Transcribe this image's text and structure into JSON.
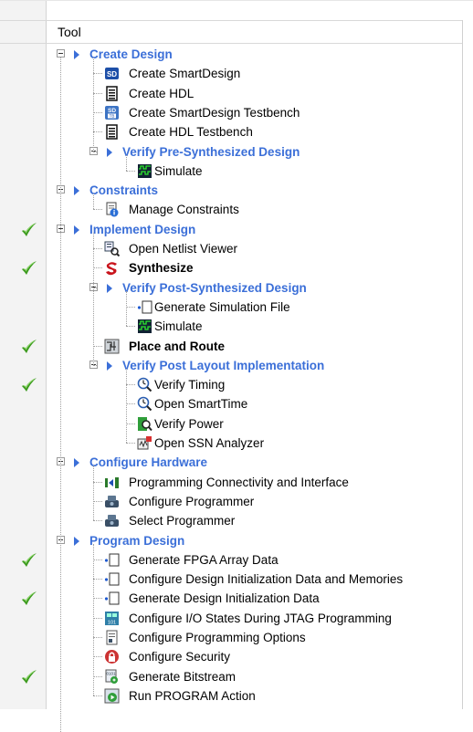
{
  "header": {
    "title": "Tool"
  },
  "colors": {
    "group": "#3b6fd8",
    "check": "#3c9a1e"
  },
  "rows": [
    {
      "label": "Create Design",
      "level": 0,
      "kind": "group",
      "checked": false
    },
    {
      "label": "Create SmartDesign",
      "level": 1,
      "icon": "smartdesign-icon",
      "checked": false
    },
    {
      "label": "Create HDL",
      "level": 1,
      "icon": "document-icon",
      "checked": false
    },
    {
      "label": "Create SmartDesign Testbench",
      "level": 1,
      "icon": "smartdesign-testbench-icon",
      "checked": false
    },
    {
      "label": "Create HDL Testbench",
      "level": 1,
      "icon": "document-icon",
      "checked": false
    },
    {
      "label": "Verify Pre-Synthesized Design",
      "level": 1,
      "kind": "group",
      "checked": false
    },
    {
      "label": "Simulate",
      "level": 2,
      "icon": "waveform-icon",
      "checked": false
    },
    {
      "label": "Constraints",
      "level": 0,
      "kind": "group",
      "checked": false
    },
    {
      "label": "Manage Constraints",
      "level": 1,
      "icon": "constraints-icon",
      "checked": false
    },
    {
      "label": "Implement Design",
      "level": 0,
      "kind": "group",
      "checked": true
    },
    {
      "label": "Open Netlist Viewer",
      "level": 1,
      "icon": "netlist-viewer-icon",
      "checked": false
    },
    {
      "label": "Synthesize",
      "level": 1,
      "icon": "synthesize-icon",
      "bold": true,
      "checked": true
    },
    {
      "label": "Verify Post-Synthesized Design",
      "level": 1,
      "kind": "group",
      "checked": false
    },
    {
      "label": "Generate Simulation File",
      "level": 2,
      "icon": "generate-file-icon",
      "checked": false
    },
    {
      "label": "Simulate",
      "level": 2,
      "icon": "waveform-icon",
      "checked": false
    },
    {
      "label": "Place and Route",
      "level": 1,
      "icon": "place-route-icon",
      "bold": true,
      "checked": true
    },
    {
      "label": "Verify Post Layout Implementation",
      "level": 1,
      "kind": "group",
      "checked": false
    },
    {
      "label": "Verify Timing",
      "level": 2,
      "icon": "timing-icon",
      "checked": true
    },
    {
      "label": "Open SmartTime",
      "level": 2,
      "icon": "timing-icon",
      "checked": false
    },
    {
      "label": "Verify Power",
      "level": 2,
      "icon": "power-icon",
      "checked": false
    },
    {
      "label": "Open SSN Analyzer",
      "level": 2,
      "icon": "ssn-analyzer-icon",
      "checked": false
    },
    {
      "label": "Configure Hardware",
      "level": 0,
      "kind": "group",
      "checked": false
    },
    {
      "label": "Programming Connectivity and Interface",
      "level": 1,
      "icon": "connectivity-icon",
      "checked": false
    },
    {
      "label": "Configure Programmer",
      "level": 1,
      "icon": "programmer-icon",
      "checked": false
    },
    {
      "label": "Select Programmer",
      "level": 1,
      "icon": "programmer-icon",
      "checked": false
    },
    {
      "label": "Program Design",
      "level": 0,
      "kind": "group",
      "checked": false
    },
    {
      "label": "Generate FPGA Array Data",
      "level": 1,
      "icon": "generate-file-icon",
      "checked": true
    },
    {
      "label": "Configure Design Initialization Data and Memories",
      "level": 1,
      "icon": "generate-file-icon",
      "checked": false
    },
    {
      "label": "Generate Design Initialization Data",
      "level": 1,
      "icon": "generate-file-icon",
      "checked": true
    },
    {
      "label": "Configure I/O States During JTAG Programming",
      "level": 1,
      "icon": "io-states-icon",
      "checked": false
    },
    {
      "label": "Configure Programming Options",
      "level": 1,
      "icon": "programming-options-icon",
      "checked": false
    },
    {
      "label": "Configure Security",
      "level": 1,
      "icon": "security-icon",
      "checked": false
    },
    {
      "label": "Generate Bitstream",
      "level": 1,
      "icon": "bitstream-icon",
      "checked": true
    },
    {
      "label": "Run PROGRAM Action",
      "level": 1,
      "icon": "run-program-icon",
      "checked": false
    }
  ]
}
